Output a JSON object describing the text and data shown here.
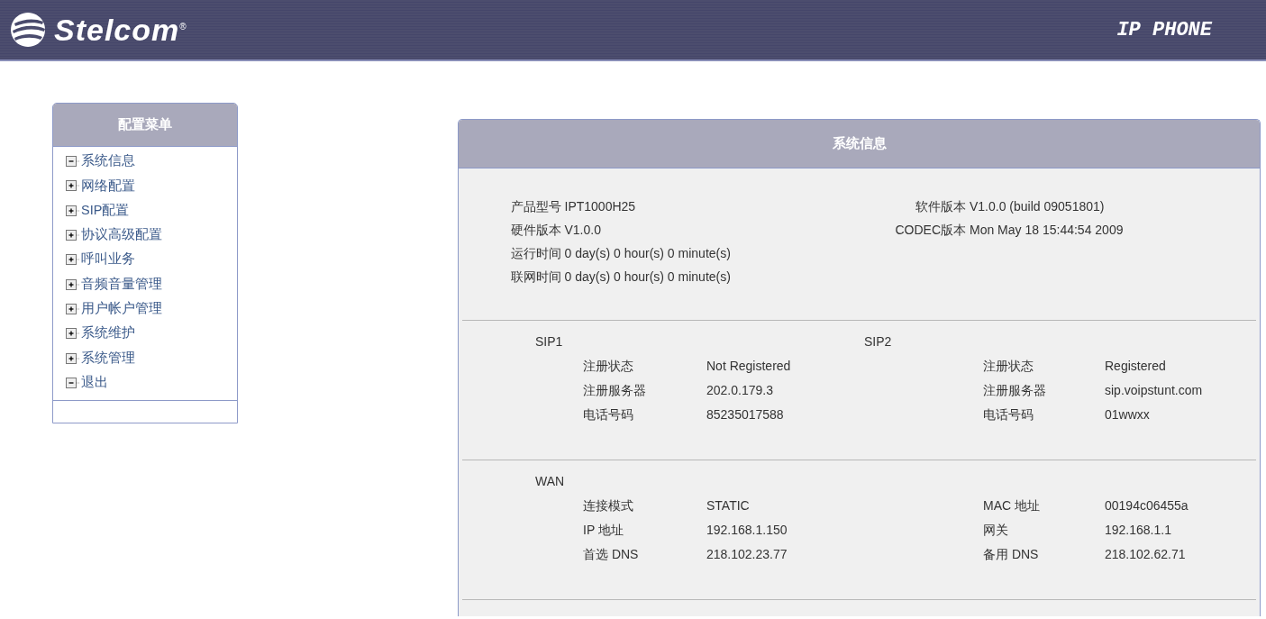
{
  "header": {
    "brand": "Stelcom",
    "trademark": "®",
    "product": "IP PHONE"
  },
  "sidebar": {
    "title": "配置菜单",
    "items": [
      {
        "label": "系统信息",
        "expanded": true
      },
      {
        "label": "网络配置",
        "expanded": false
      },
      {
        "label": "SIP配置",
        "expanded": false
      },
      {
        "label": "协议高级配置",
        "expanded": false
      },
      {
        "label": "呼叫业务",
        "expanded": false
      },
      {
        "label": "音频音量管理",
        "expanded": false
      },
      {
        "label": "用户帐户管理",
        "expanded": false
      },
      {
        "label": "系统维护",
        "expanded": false
      },
      {
        "label": "系统管理",
        "expanded": false
      },
      {
        "label": "退出",
        "expanded": true
      }
    ]
  },
  "panel": {
    "title": "系统信息",
    "system_info": {
      "left": [
        {
          "label": "产品型号",
          "value": "IPT1000H25"
        },
        {
          "label": "硬件版本",
          "value": "V1.0.0"
        },
        {
          "label": "运行时间",
          "value": "0 day(s) 0 hour(s) 0 minute(s)"
        },
        {
          "label": "联网时间",
          "value": "0 day(s) 0 hour(s) 0 minute(s)"
        }
      ],
      "right": [
        {
          "label": "软件版本",
          "value": "V1.0.0 (build 09051801)"
        },
        {
          "label": "CODEC版本",
          "value": "Mon May 18 15:44:54 2009"
        }
      ]
    },
    "sections": [
      {
        "left": {
          "name": "SIP1",
          "fields": [
            {
              "label": "注册状态",
              "value": "Not Registered"
            },
            {
              "label": "注册服务器",
              "value": "202.0.179.3"
            },
            {
              "label": "电话号码",
              "value": "85235017588"
            }
          ]
        },
        "right": {
          "name": "SIP2",
          "fields": [
            {
              "label": "注册状态",
              "value": "Registered"
            },
            {
              "label": "注册服务器",
              "value": "sip.voipstunt.com"
            },
            {
              "label": "电话号码",
              "value": "01wwxx"
            }
          ]
        }
      },
      {
        "left": {
          "name": "WAN",
          "fields": [
            {
              "label": "连接模式",
              "value": "STATIC"
            },
            {
              "label": "IP 地址",
              "value": "192.168.1.150"
            },
            {
              "label": "首选 DNS",
              "value": "218.102.23.77"
            }
          ]
        },
        "right": {
          "fields": [
            {
              "label": "MAC 地址",
              "value": "00194c06455a"
            },
            {
              "label": "网关",
              "value": "192.168.1.1"
            },
            {
              "label": "备用 DNS",
              "value": "218.102.62.71"
            }
          ]
        }
      }
    ]
  }
}
